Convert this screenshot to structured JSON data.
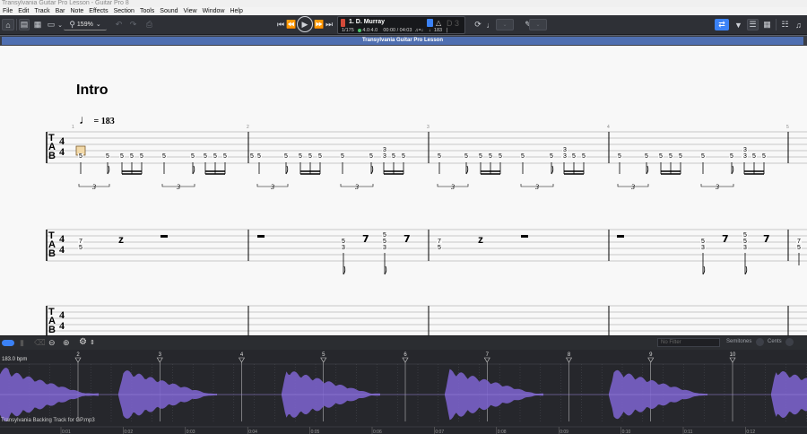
{
  "window": {
    "title": "Transylvania Guitar Pro Lesson - Guitar Pro 8"
  },
  "menu": [
    "File",
    "Edit",
    "Track",
    "Bar",
    "Note",
    "Effects",
    "Section",
    "Tools",
    "Sound",
    "View",
    "Window",
    "Help"
  ],
  "toolbar": {
    "zoom": "159%"
  },
  "lcd": {
    "track_name": "1. D. Murray",
    "bar_position": "1/175",
    "time_signature": "4.0:4.0",
    "time": "00:00 / 04:03",
    "tempo": "183",
    "key": "D 3"
  },
  "document": {
    "tab_title": "Transylvania Guitar Pro Lesson"
  },
  "score": {
    "section_title": "Intro",
    "tempo_marking": "= 183",
    "bar_numbers": [
      "1",
      "2",
      "3",
      "4",
      "5"
    ],
    "tuplet_label": "3",
    "time_signature": "4/4",
    "tab_clef": [
      "T",
      "A",
      "B"
    ]
  },
  "bottom_panel": {
    "filter_placeholder": "No Filter",
    "semitones_label": "Semitones",
    "cents_label": "Cents",
    "bpm": "183.0 bpm",
    "audio_file": "Transylvania Backing Track for GP.mp3",
    "markers": [
      "2",
      "3",
      "4",
      "5",
      "6",
      "7",
      "8",
      "9",
      "10"
    ],
    "time_ticks": [
      "0:01",
      "0:02",
      "0:03",
      "0:04",
      "0:05",
      "0:06",
      "0:07",
      "0:08",
      "0:09",
      "0:10",
      "0:11",
      "0:12"
    ]
  },
  "colors": {
    "accent": "#3b82f6",
    "waveform": "#7a62c9",
    "doc_tab": "#4f6fb1",
    "toolbar_bg": "#2e3036"
  }
}
